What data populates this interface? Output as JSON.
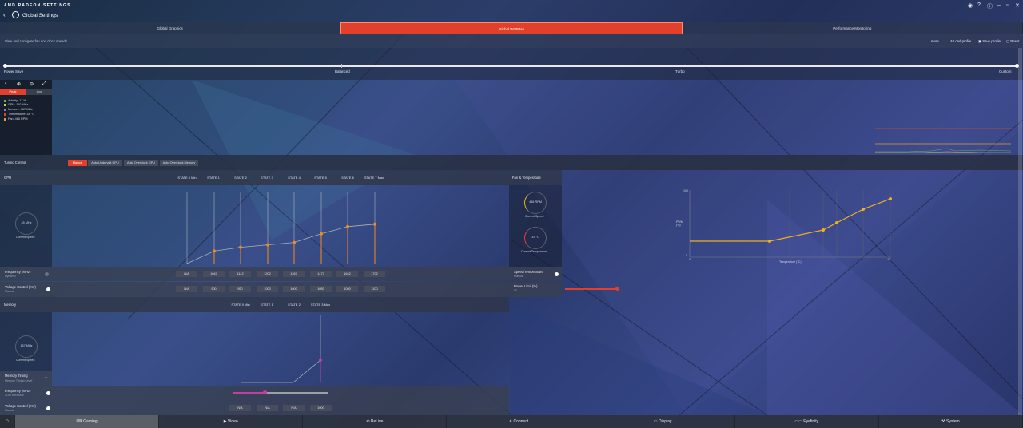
{
  "app": {
    "brand": "AMD",
    "brand_sub": "RADEON SETTINGS",
    "title": "Global Settings"
  },
  "tabs": [
    {
      "label": "Global Graphics",
      "active": false
    },
    {
      "label": "Global WattMan",
      "active": true
    },
    {
      "label": "Performance Monitoring",
      "active": false
    }
  ],
  "subbar": {
    "description": "View and configure fan and clock speeds...",
    "more": "more...",
    "load": "Load profile",
    "save": "Save profile",
    "reset": "Reset"
  },
  "profile": {
    "labels": [
      "Power Save",
      "Balanced",
      "Turbo",
      "Custom"
    ],
    "selected": "Custom"
  },
  "monitor": {
    "tabs": [
      "Peak",
      "Avg"
    ],
    "legend": [
      {
        "text": "Activity: 17 %",
        "color": "#6ab04c"
      },
      {
        "text": "GPU: 110 MHz",
        "color": "#e6c04a"
      },
      {
        "text": "Memory: 167 MHz",
        "color": "#a06ad0"
      },
      {
        "text": "Temperature: 34 °C",
        "color": "#e2402a"
      },
      {
        "text": "Fan: 466 RPM",
        "color": "#e69a2a"
      }
    ]
  },
  "tuning": {
    "label": "Tuning Control",
    "options": [
      "Manual",
      "Auto Undervolt GPU",
      "Auto Overclock GPU",
      "Auto Overclock Memory"
    ],
    "selected": "Manual"
  },
  "gpu": {
    "title": "GPU",
    "states": [
      "STATE 0 Min",
      "STATE 1",
      "STATE 2",
      "STATE 3",
      "STATE 4",
      "STATE 5",
      "STATE 6",
      "STATE 7 Max"
    ],
    "gauge_value": "45 MHz",
    "gauge_label": "Current Speed",
    "frequency": {
      "label": "Frequency (MHz)",
      "mode": "Dynamic",
      "values": [
        "N/A",
        "1047",
        "1142",
        "1202",
        "1267",
        "1477",
        "1642",
        "1702"
      ]
    },
    "voltage": {
      "label": "Voltage Control (mV)",
      "mode": "Manual",
      "values": [
        "N/A",
        "900",
        "950",
        "1000",
        "1000",
        "1050",
        "1050",
        "1100"
      ]
    },
    "curve": [
      0,
      0.26,
      0.34,
      0.39,
      0.44,
      0.62,
      0.77,
      0.82
    ]
  },
  "memory": {
    "title": "Memory",
    "states": [
      "STATE 0 Min",
      "STATE 1",
      "STATE 2",
      "STATE 3 Max"
    ],
    "gauge_value": "167 MHz",
    "gauge_label": "Current Speed",
    "timing": {
      "label": "Memory Timing",
      "value": "Memory Timing Level 1"
    },
    "frequency": {
      "label": "Frequency (MHz)",
      "value": "1100 MHz Max"
    },
    "voltage": {
      "label": "Voltage Control (mV)",
      "mode": "Manual",
      "values": [
        "N/A",
        "N/A",
        "N/A",
        "1000"
      ]
    }
  },
  "fan": {
    "title": "Fan & Temperature",
    "rpm": "466 RPM",
    "rpm_label": "Current Speed",
    "temp": "33 °C",
    "temp_label": "Current Temperature",
    "speed_temp": {
      "label": "Speed/Temperature",
      "mode": "Manual"
    },
    "power": {
      "label": "Power Limit (%)",
      "value": "50"
    },
    "chart": {
      "ylabel": "PWM (%)",
      "xlabel": "Temperature (°C)",
      "ymax": "100",
      "ymin": "0",
      "xmin": "0",
      "xmax": "75"
    }
  },
  "bottom": [
    "Gaming",
    "Video",
    "ReLive",
    "Connect",
    "Display",
    "Eyefinity",
    "System"
  ]
}
